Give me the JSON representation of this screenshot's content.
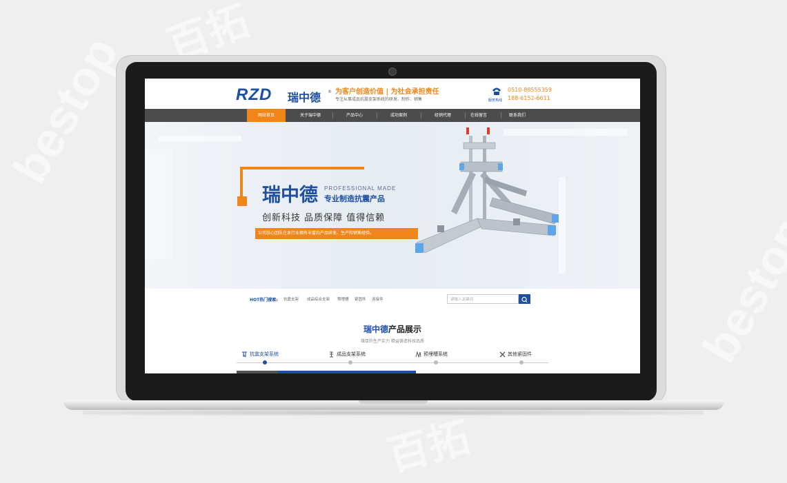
{
  "header": {
    "logo_latin": "RZD",
    "logo_cn": "瑞中德",
    "logo_reg": "®",
    "slogan": "为客户创造价值 | 为社会承担责任",
    "slogan_sub": "专注从事成品抗震支架系统的研发、制作、销售",
    "phone_caption": "服务热线",
    "phone1": "0510-88555359",
    "phone2": "188-6152-6611"
  },
  "nav": {
    "items": [
      "网站首页",
      "关于瑞中德",
      "产品中心",
      "成功案例",
      "经销代理",
      "在线留言",
      "联系我们"
    ]
  },
  "banner": {
    "title": "瑞中德",
    "en": "PROFESSIONAL MADE",
    "sub": "专业制造抗震产品",
    "tagline": "创新科技  品质保障  值得信赖",
    "strip": "公司核心团队在本行业拥有丰富的产品研发、生产和销售经验。"
  },
  "hot": {
    "label": "HOT热门搜索:",
    "items": [
      "抗震支架",
      "成品综合支架",
      "预埋槽",
      "紧固件",
      "连接件"
    ],
    "search_placeholder": "请输入关键词"
  },
  "products": {
    "title_blue": "瑞中德",
    "title_rest": "产品展示",
    "sub": "雄厚的生产实力  精益铸造科技品质",
    "tabs": [
      "抗震支架系统",
      "成品支架系统",
      "预埋槽系统",
      "其他紧固件"
    ]
  },
  "colors": {
    "brand_blue": "#1e4fa1",
    "accent_orange": "#f08519",
    "nav_bg": "#4c4c4c"
  }
}
